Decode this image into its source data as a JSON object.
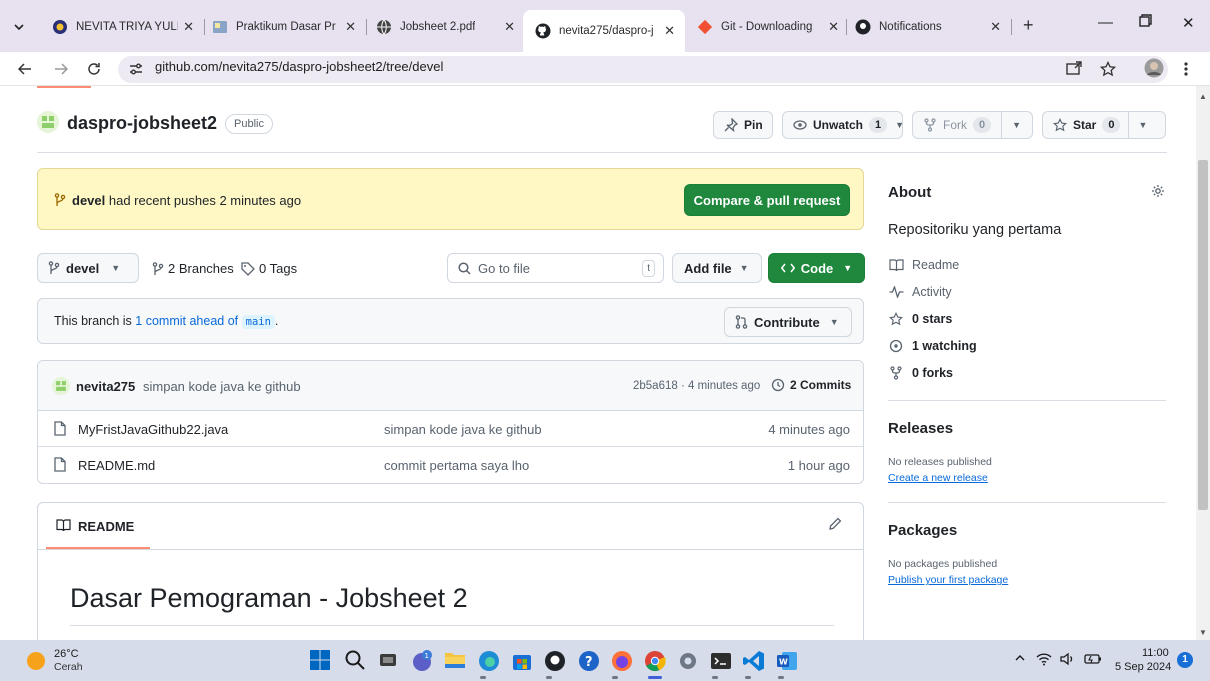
{
  "browser": {
    "tabs": [
      {
        "title": "NEVITA TRIYA YULI",
        "active": false
      },
      {
        "title": "Praktikum Dasar Pr",
        "active": false
      },
      {
        "title": "Jobsheet 2.pdf",
        "active": false
      },
      {
        "title": "nevita275/daspro-j",
        "active": true
      },
      {
        "title": "Git - Downloading",
        "active": false
      },
      {
        "title": "Notifications",
        "active": false
      }
    ],
    "url": "github.com/nevita275/daspro-jobsheet2/tree/devel"
  },
  "repo": {
    "name": "daspro-jobsheet2",
    "visibility": "Public",
    "actions": {
      "pin": "Pin",
      "unwatch": "Unwatch",
      "watch_count": "1",
      "fork": "Fork",
      "fork_count": "0",
      "star": "Star",
      "star_count": "0"
    }
  },
  "push_banner": {
    "branch": "devel",
    "message": "had recent pushes 2 minutes ago",
    "button": "Compare & pull request"
  },
  "toolbar": {
    "branch": "devel",
    "branches": "2 Branches",
    "tags": "0 Tags",
    "search_placeholder": "Go to file",
    "search_shortcut": "t",
    "add_file": "Add file",
    "code": "Code"
  },
  "ahead": {
    "prefix": "This branch is",
    "link": "1 commit ahead of",
    "base": "main",
    "suffix": ".",
    "contribute": "Contribute"
  },
  "latest_commit": {
    "author": "nevita275",
    "message": "simpan kode java ke github",
    "meta": "2b5a618 · 4 minutes ago",
    "commits": "2 Commits"
  },
  "files": [
    {
      "name": "MyFristJavaGithub22.java",
      "message": "simpan kode java ke github",
      "time": "4 minutes ago"
    },
    {
      "name": "README.md",
      "message": "commit pertama saya lho",
      "time": "1 hour ago"
    }
  ],
  "readme": {
    "tab": "README",
    "heading": "Dasar Pemograman - Jobsheet 2"
  },
  "about": {
    "title": "About",
    "description": "Repositoriku yang pertama",
    "readme": "Readme",
    "activity": "Activity",
    "stars": "0 stars",
    "watching": "1 watching",
    "forks": "0 forks"
  },
  "releases": {
    "title": "Releases",
    "empty": "No releases published",
    "create": "Create a new release"
  },
  "packages": {
    "title": "Packages",
    "empty": "No packages published",
    "publish": "Publish your first package"
  },
  "taskbar": {
    "temperature": "26°C",
    "weather": "Cerah",
    "time": "11:00",
    "date": "5 Sep 2024",
    "notifications": "1"
  },
  "colors": {
    "accent_green": "#1f883d",
    "link_blue": "#0969da",
    "banner_yellow": "#fff8c5",
    "tab_underline": "#fd8c73"
  }
}
